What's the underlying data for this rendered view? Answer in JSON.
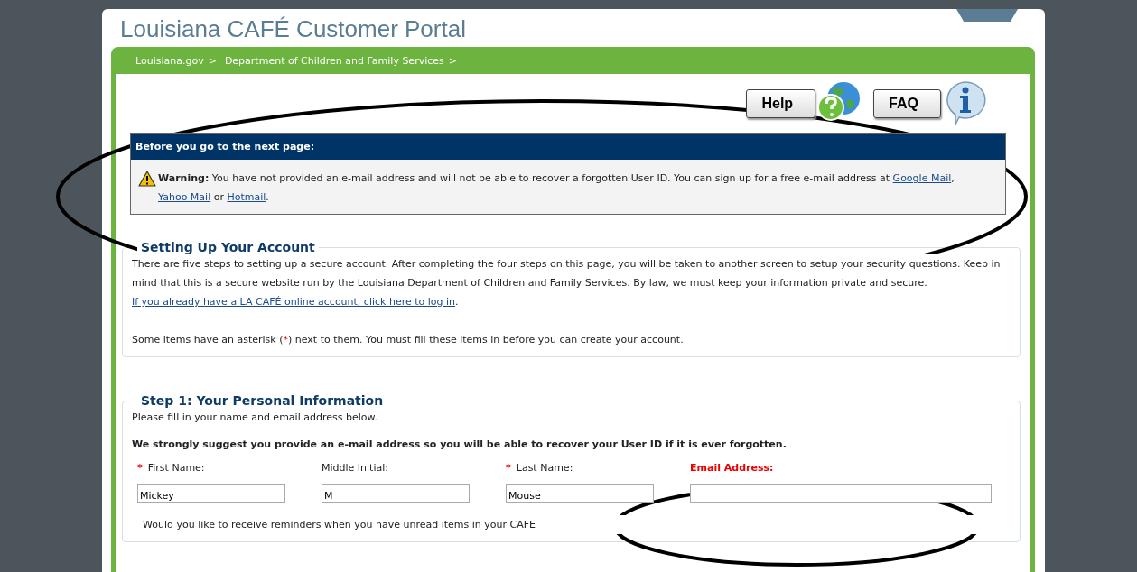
{
  "header": {
    "title": "Louisiana CAFÉ Customer Portal"
  },
  "breadcrumbs": [
    {
      "label": "Louisiana.gov",
      "separator": ">"
    },
    {
      "label": "Department of Children and Family Services",
      "separator": ">"
    }
  ],
  "help_buttons": [
    {
      "label": "Help",
      "kind": "help"
    },
    {
      "label": "FAQ",
      "kind": "faq"
    }
  ],
  "notice": {
    "title": "Before you go to the next page:",
    "warning_label": "Warning:",
    "text": "You have not provided an e-mail address and will not be able to recover a forgotten User ID. You can sign up for a free e-mail address at",
    "links": [
      "Google Mail",
      "Yahoo Mail",
      "Hotmail"
    ],
    "joiners": [
      ",",
      "or",
      "."
    ]
  },
  "account_section": {
    "title": "Setting Up Your Account",
    "intro": "There are five steps to setting up a secure account. After completing the four steps on this page, you will be taken to another screen to setup your security questions. Keep in mind that this is a secure website run by the Louisiana Department of Children and Family Services. By law, we must keep your information private and secure.",
    "login_link": "If you already have a LA CAFÉ online account, click here to log in",
    "login_end": ".",
    "asterisk_before": "Some items have an asterisk (",
    "asterisk": "*",
    "asterisk_after": ") next to them. You must fill these items in before you can create your account."
  },
  "step1": {
    "title": "Step 1: Your Personal Information",
    "instructions": "Please fill in your name and email address below.",
    "suggestion": "We strongly suggest you provide an e-mail address so you will be able to recover your User ID if it is ever forgotten.",
    "fields": [
      {
        "label": "First Name:",
        "required": true,
        "highlighted": false,
        "value": "Mickey"
      },
      {
        "label": "Middle Initial:",
        "required": false,
        "highlighted": false,
        "value": "M"
      },
      {
        "label": "Last Name:",
        "required": true,
        "highlighted": false,
        "value": "Mouse"
      },
      {
        "label": "Email Address:",
        "required": false,
        "highlighted": true
      }
    ],
    "required_mark": "*",
    "reminder_question": "Would you like to receive reminders when you have unread items in your CAFE"
  }
}
